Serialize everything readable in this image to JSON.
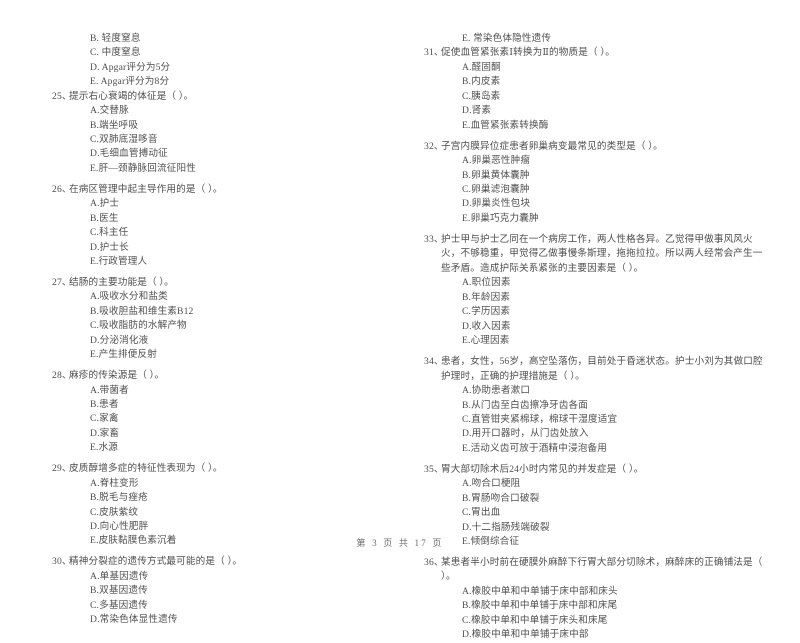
{
  "document": {
    "type": "exam-paper",
    "footer": "第 3 页  共 17 页",
    "page_number": 3,
    "total_pages": 17
  },
  "left_column": {
    "continued_options": [
      {
        "label": "B.",
        "text": "轻度窒息"
      },
      {
        "label": "C.",
        "text": "中度窒息"
      },
      {
        "label": "D.",
        "text": "Apgar评分为5分"
      },
      {
        "label": "E.",
        "text": "Apgar评分为8分"
      }
    ],
    "questions": [
      {
        "number": "25、",
        "stem": "提示右心衰竭的体征是（      ）。",
        "options": [
          {
            "label": "A.",
            "text": "交替脉"
          },
          {
            "label": "B.",
            "text": "端坐呼吸"
          },
          {
            "label": "C.",
            "text": "双肺底湿哆音"
          },
          {
            "label": "D.",
            "text": "毛细血管搏动征"
          },
          {
            "label": "E.",
            "text": "肝—颈静脉回流征阳性"
          }
        ]
      },
      {
        "number": "26、",
        "stem": "在病区管理中起主导作用的是（      ）。",
        "options": [
          {
            "label": "A.",
            "text": "护士"
          },
          {
            "label": "B.",
            "text": "医生"
          },
          {
            "label": "C.",
            "text": "科主任"
          },
          {
            "label": "D.",
            "text": "护士长"
          },
          {
            "label": "E.",
            "text": "行政管理人"
          }
        ]
      },
      {
        "number": "27、",
        "stem": "结肠的主要功能是（      ）。",
        "options": [
          {
            "label": "A.",
            "text": "吸收水分和盐类"
          },
          {
            "label": "B.",
            "text": "吸收胆盐和维生素B12"
          },
          {
            "label": "C.",
            "text": "吸收脂肪的水解产物"
          },
          {
            "label": "D.",
            "text": "分泌消化液"
          },
          {
            "label": "E.",
            "text": "产生排便反射"
          }
        ]
      },
      {
        "number": "28、",
        "stem": "麻疹的传染源是（      ）。",
        "options": [
          {
            "label": "A.",
            "text": "带菌者"
          },
          {
            "label": "B.",
            "text": "患者"
          },
          {
            "label": "C.",
            "text": "家禽"
          },
          {
            "label": "D.",
            "text": "家畜"
          },
          {
            "label": "E.",
            "text": "水源"
          }
        ]
      },
      {
        "number": "29、",
        "stem": "皮质醇增多症的特征性表现为（      ）。",
        "options": [
          {
            "label": "A.",
            "text": "脊柱变形"
          },
          {
            "label": "B.",
            "text": "脱毛与痤疮"
          },
          {
            "label": "C.",
            "text": "皮肤紫纹"
          },
          {
            "label": "D.",
            "text": "向心性肥胖"
          },
          {
            "label": "E.",
            "text": "皮肤黏膜色素沉着"
          }
        ]
      },
      {
        "number": "30、",
        "stem": "精神分裂症的遗传方式最可能的是（      ）。",
        "options": [
          {
            "label": "A.",
            "text": "单基因遗传"
          },
          {
            "label": "B.",
            "text": "双基因遗传"
          },
          {
            "label": "C.",
            "text": "多基因遗传"
          },
          {
            "label": "D.",
            "text": "常染色体显性遗传"
          }
        ]
      }
    ]
  },
  "right_column": {
    "continued_options": [
      {
        "label": "E.",
        "text": "常染色体隐性遗传"
      }
    ],
    "questions": [
      {
        "number": "31、",
        "stem": "促使血管紧张素Ⅰ转换为Ⅱ的物质是（      ）。",
        "options": [
          {
            "label": "A.",
            "text": "醛固酮"
          },
          {
            "label": "B.",
            "text": "内皮素"
          },
          {
            "label": "C.",
            "text": "胰岛素"
          },
          {
            "label": "D.",
            "text": "肾素"
          },
          {
            "label": "E.",
            "text": "血管紧张素转换酶"
          }
        ]
      },
      {
        "number": "32、",
        "stem": "子宫内膜异位症患者卵巢病变最常见的类型是（      ）。",
        "options": [
          {
            "label": "A.",
            "text": "卵巢恶性肿瘤"
          },
          {
            "label": "B.",
            "text": "卵巢黄体囊肿"
          },
          {
            "label": "C.",
            "text": "卵巢滤泡囊肿"
          },
          {
            "label": "D.",
            "text": "卵巢炎性包块"
          },
          {
            "label": "E.",
            "text": "卵巢巧克力囊肿"
          }
        ]
      },
      {
        "number": "33、",
        "stem": "护士甲与护士乙同在一个病房工作，两人性格各异。乙觉得甲做事风风火火，不够稳重，甲觉得乙做事慢条斯理，拖拖拉拉。所以两人经常会产生一些矛盾。造成护际关系紧张的主要因素是（      ）。",
        "options": [
          {
            "label": "A.",
            "text": "职位因素"
          },
          {
            "label": "B.",
            "text": "年龄因素"
          },
          {
            "label": "C.",
            "text": "学历因素"
          },
          {
            "label": "D.",
            "text": "收入因素"
          },
          {
            "label": "E.",
            "text": "心理因素"
          }
        ]
      },
      {
        "number": "34、",
        "stem": "患者，女性，56岁，高空坠落伤，目前处于昏迷状态。护士小刘为其做口腔护理时，正确的护理措施是（      ）。",
        "options": [
          {
            "label": "A.",
            "text": "协助患者漱口"
          },
          {
            "label": "B.",
            "text": "从门齿至白齿擦净牙齿各面"
          },
          {
            "label": "C.",
            "text": "直管钳夹紧棉球，棉球干湿度适宜"
          },
          {
            "label": "D.",
            "text": "用开口器时，从门齿处放入"
          },
          {
            "label": "E.",
            "text": "活动义齿可放于酒精中浸泡备用"
          }
        ]
      },
      {
        "number": "35、",
        "stem": "胃大部切除术后24小时内常见的并发症是（      ）。",
        "options": [
          {
            "label": "A.",
            "text": "吻合口梗阻"
          },
          {
            "label": "B.",
            "text": "胃肠吻合口破裂"
          },
          {
            "label": "C.",
            "text": "胃出血"
          },
          {
            "label": "D.",
            "text": "十二指肠残端破裂"
          },
          {
            "label": "E.",
            "text": "倾倒综合征"
          }
        ]
      },
      {
        "number": "36、",
        "stem": "某患者半小时前在硬膜外麻醉下行胃大部分切除术，麻醉床的正确铺法是（      ）。",
        "options": [
          {
            "label": "A.",
            "text": "橡胶中单和中单铺于床中部和床头"
          },
          {
            "label": "B.",
            "text": "橡胶中单和中单铺于床中部和床尾"
          },
          {
            "label": "C.",
            "text": "橡胶中单和中单铺于床头和床尾"
          },
          {
            "label": "D.",
            "text": "橡胶中单和中单铺于床中部"
          }
        ]
      }
    ]
  }
}
